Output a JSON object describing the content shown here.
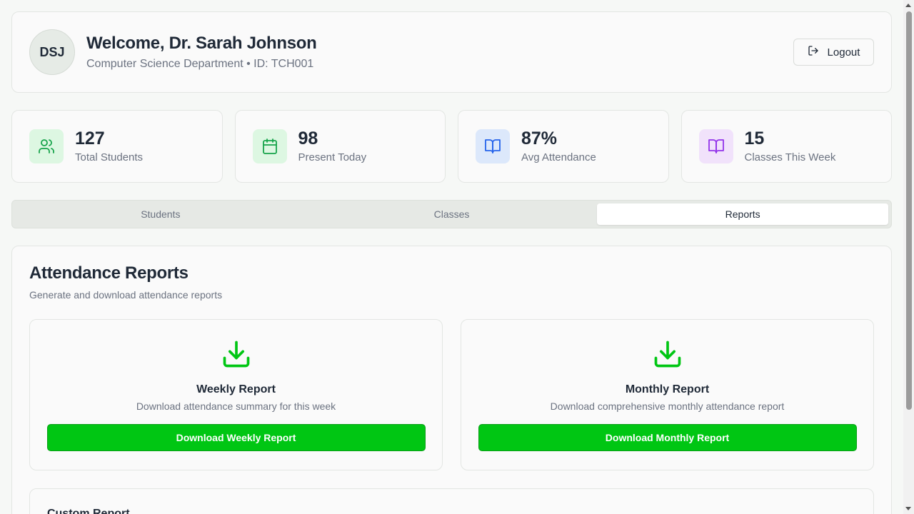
{
  "header": {
    "avatar_initials": "DSJ",
    "welcome": "Welcome, Dr. Sarah Johnson",
    "subtitle": "Computer Science Department • ID: TCH001",
    "logout_label": "Logout"
  },
  "stats": [
    {
      "value": "127",
      "label": "Total Students",
      "icon": "users-icon",
      "bg": "#ddf7e2",
      "color": "#16a34a"
    },
    {
      "value": "98",
      "label": "Present Today",
      "icon": "calendar-icon",
      "bg": "#ddf7e2",
      "color": "#16a34a"
    },
    {
      "value": "87%",
      "label": "Avg Attendance",
      "icon": "book-open-icon",
      "bg": "#dce8fb",
      "color": "#2563eb"
    },
    {
      "value": "15",
      "label": "Classes This Week",
      "icon": "book-open-icon",
      "bg": "#f1e2fb",
      "color": "#9333ea"
    }
  ],
  "tabs": [
    {
      "label": "Students",
      "active": false
    },
    {
      "label": "Classes",
      "active": false
    },
    {
      "label": "Reports",
      "active": true
    }
  ],
  "reports": {
    "title": "Attendance Reports",
    "description": "Generate and download attendance reports",
    "items": [
      {
        "title": "Weekly Report",
        "description": "Download attendance summary for this week",
        "button": "Download Weekly Report",
        "icon": "download-icon"
      },
      {
        "title": "Monthly Report",
        "description": "Download comprehensive monthly attendance report",
        "button": "Download Monthly Report",
        "icon": "download-icon"
      }
    ],
    "custom_title": "Custom Report"
  },
  "colors": {
    "accent": "#00c613",
    "icon_green": "#00c613"
  }
}
